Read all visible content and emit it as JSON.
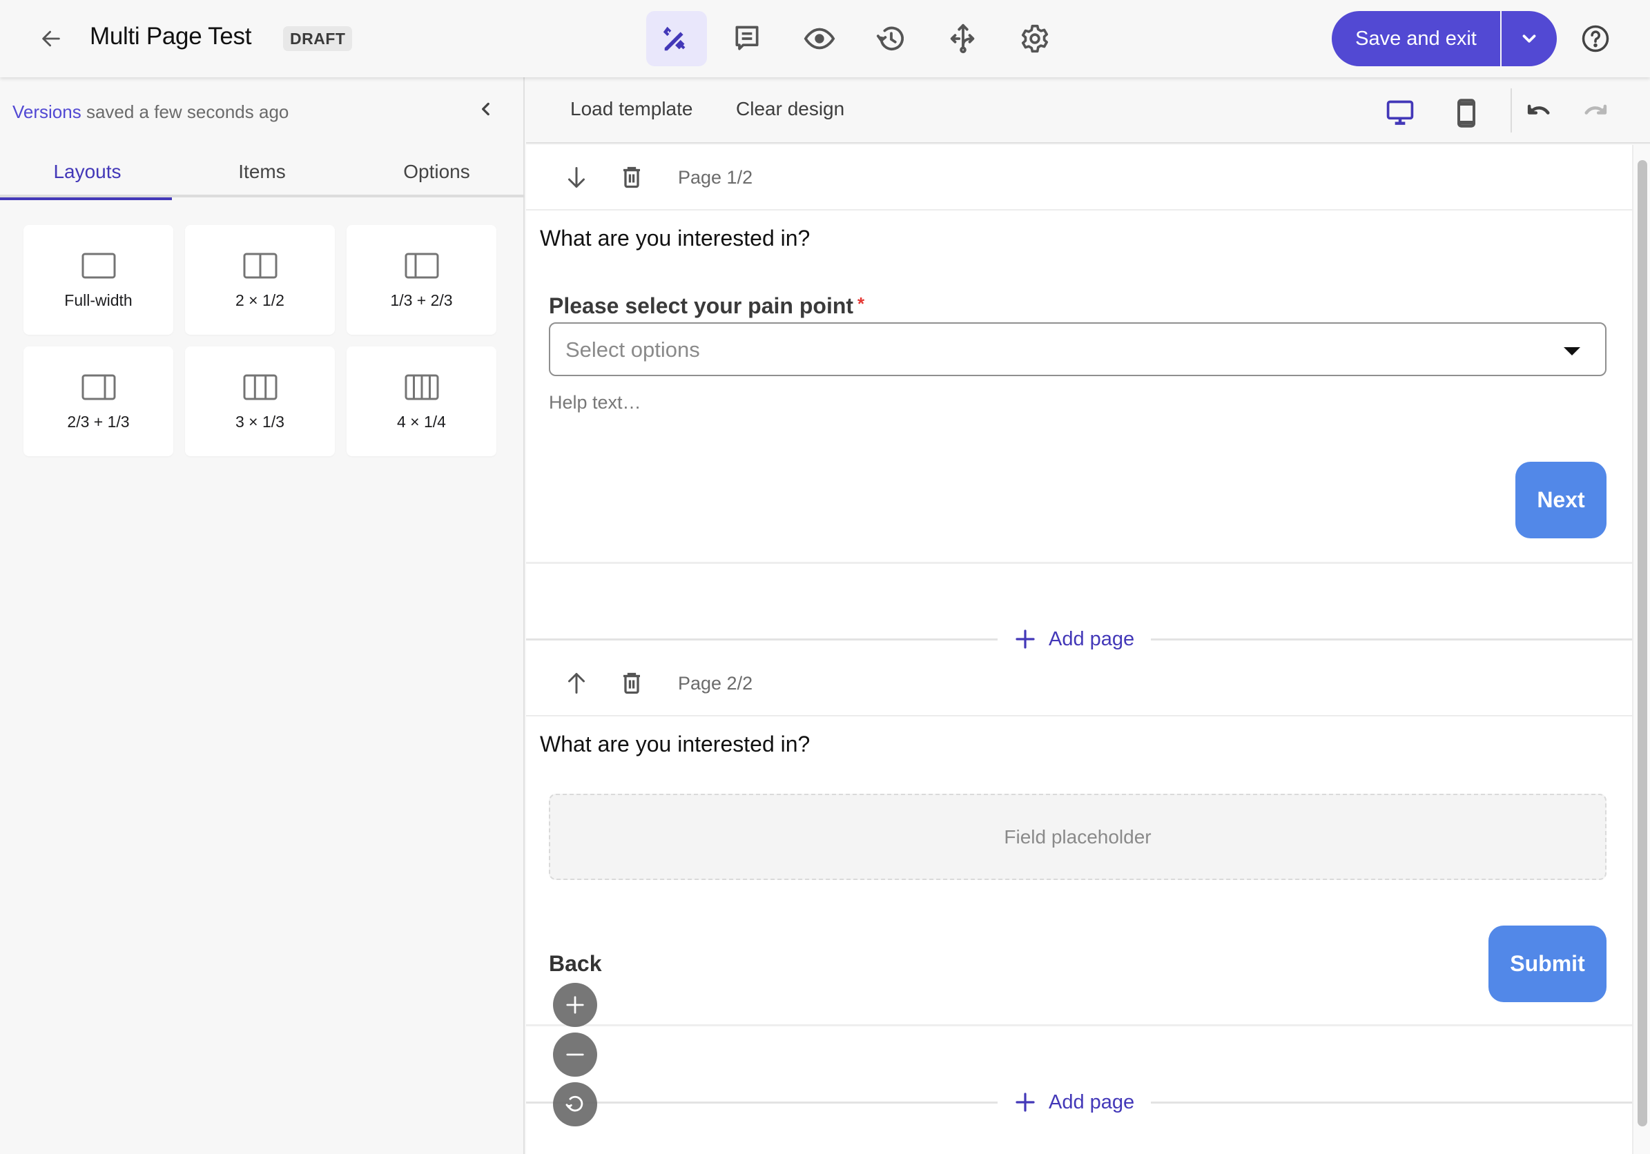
{
  "header": {
    "title": "Multi Page Test",
    "status_badge": "DRAFT",
    "modes": [
      {
        "name": "design",
        "icon": "design-tools-icon",
        "active": true
      },
      {
        "name": "comments",
        "icon": "comment-icon",
        "active": false
      },
      {
        "name": "preview",
        "icon": "eye-icon",
        "active": false
      },
      {
        "name": "history",
        "icon": "history-icon",
        "active": false
      },
      {
        "name": "logic",
        "icon": "branch-arrows-icon",
        "active": false
      },
      {
        "name": "settings",
        "icon": "gear-icon",
        "active": false
      }
    ],
    "save_label": "Save and exit",
    "colors": {
      "accent": "#5249d3",
      "active_mode_bg": "#e9e7fb"
    }
  },
  "sidebar": {
    "versions_link": "Versions",
    "versions_status": " saved a few seconds ago",
    "tabs": [
      {
        "label": "Layouts",
        "active": true
      },
      {
        "label": "Items",
        "active": false
      },
      {
        "label": "Options",
        "active": false
      }
    ],
    "layouts": [
      {
        "label": "Full-width",
        "icon": "layout-full-width-icon"
      },
      {
        "label": "2 × 1/2",
        "icon": "layout-two-halves-icon"
      },
      {
        "label": "1/3 + 2/3",
        "icon": "layout-third-two-thirds-icon"
      },
      {
        "label": "2/3 + 1/3",
        "icon": "layout-two-thirds-third-icon"
      },
      {
        "label": "3 × 1/3",
        "icon": "layout-three-thirds-icon"
      },
      {
        "label": "4 × 1/4",
        "icon": "layout-four-quarters-icon"
      }
    ]
  },
  "toolbar": {
    "load_template": "Load template",
    "clear_design": "Clear design",
    "device": "desktop",
    "redo_enabled": false
  },
  "pages": [
    {
      "label": "Page 1/2",
      "move_direction": "down",
      "question": "What are you interested in?",
      "field": {
        "label": "Please select your pain point",
        "required_mark": "*",
        "placeholder": "Select options",
        "help_text": "Help text…"
      },
      "primary_button": "Next"
    },
    {
      "label": "Page 2/2",
      "move_direction": "up",
      "question": "What are you interested in?",
      "field_placeholder": "Field placeholder",
      "back_label": "Back",
      "primary_button": "Submit"
    }
  ],
  "add_page_label": "Add page",
  "form_button_color": "#5288e8"
}
